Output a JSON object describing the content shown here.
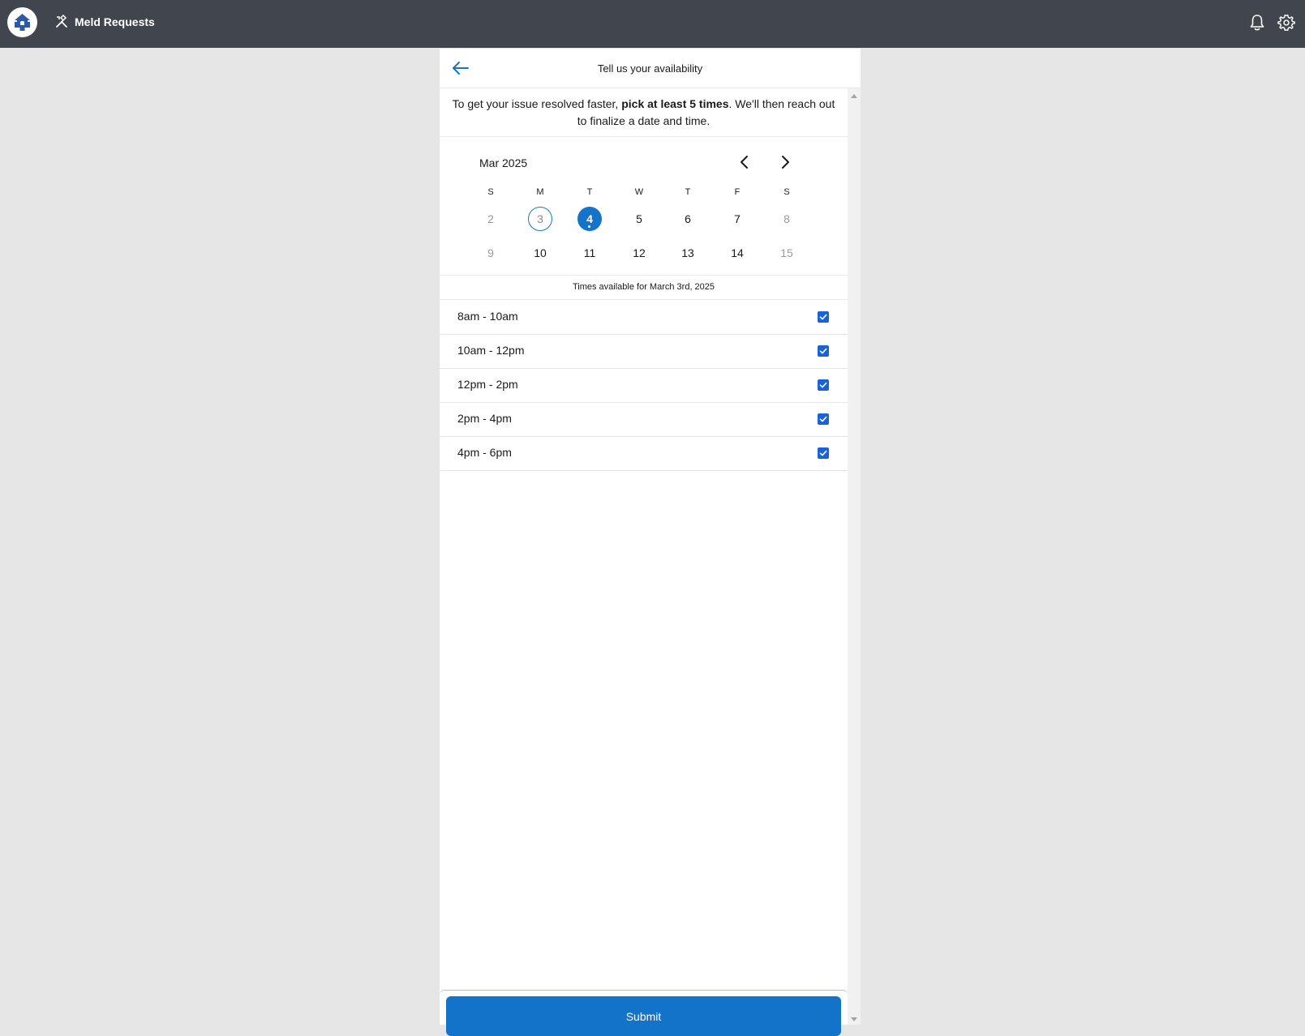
{
  "topbar": {
    "app_title": "Meld Requests",
    "logo_icon": "house-logo-icon",
    "app_icon": "tools-icon",
    "right_icons": [
      "bell-icon",
      "gear-icon"
    ]
  },
  "panel": {
    "title": "Tell us your availability",
    "back_icon": "arrow-left-icon"
  },
  "intro": {
    "prefix": "To get your issue resolved faster, ",
    "emphasis": "pick at least 5 times",
    "suffix": ". We'll then reach out to finalize a date and time."
  },
  "calendar": {
    "month_label": "Mar 2025",
    "weekdays": [
      "S",
      "M",
      "T",
      "W",
      "T",
      "F",
      "S"
    ],
    "weeks": [
      [
        {
          "label": "2",
          "state": "disabled"
        },
        {
          "label": "3",
          "state": "today"
        },
        {
          "label": "4",
          "state": "selected"
        },
        {
          "label": "5",
          "state": "normal"
        },
        {
          "label": "6",
          "state": "normal"
        },
        {
          "label": "7",
          "state": "normal"
        },
        {
          "label": "8",
          "state": "disabled"
        }
      ],
      [
        {
          "label": "9",
          "state": "disabled"
        },
        {
          "label": "10",
          "state": "normal"
        },
        {
          "label": "11",
          "state": "normal"
        },
        {
          "label": "12",
          "state": "normal"
        },
        {
          "label": "13",
          "state": "normal"
        },
        {
          "label": "14",
          "state": "normal"
        },
        {
          "label": "15",
          "state": "disabled"
        }
      ]
    ]
  },
  "times": {
    "heading": "Times available for March 3rd, 2025",
    "slots": [
      {
        "label": "8am - 10am",
        "checked": true
      },
      {
        "label": "10am - 12pm",
        "checked": true
      },
      {
        "label": "12pm - 2pm",
        "checked": true
      },
      {
        "label": "2pm - 4pm",
        "checked": true
      },
      {
        "label": "4pm - 6pm",
        "checked": true
      }
    ]
  },
  "submit": {
    "label": "Submit"
  },
  "colors": {
    "topbar": "#41454d",
    "accent": "#1573c9",
    "checkbox": "#1a63d6",
    "page_background": "#e6e6e6"
  }
}
